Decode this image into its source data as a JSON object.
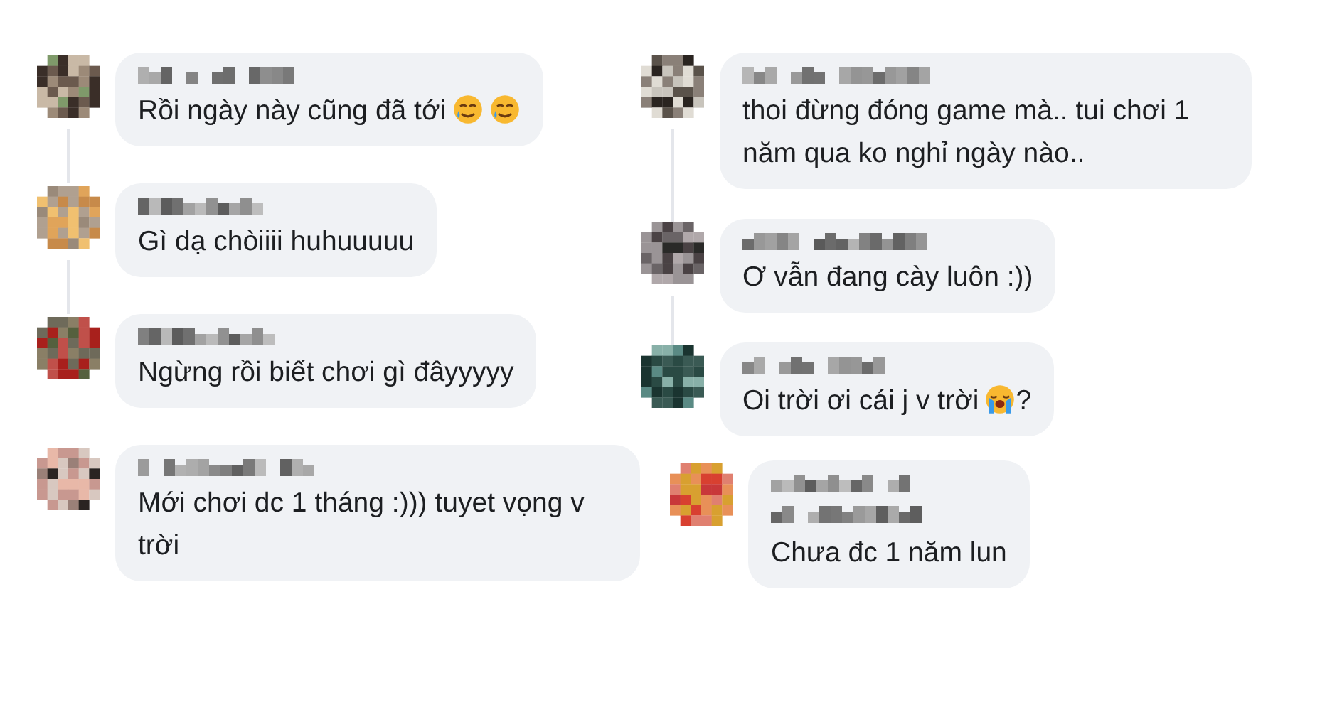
{
  "columns": [
    {
      "comments": [
        {
          "kind": "comment",
          "thread_line": true,
          "parts": [
            {
              "kind": "text",
              "text": "Rồi ngày này cũng đã tới"
            },
            {
              "kind": "smiling-tear"
            },
            {
              "kind": "smiling-tear"
            }
          ]
        },
        {
          "kind": "comment",
          "thread_line": true,
          "parts": [
            {
              "kind": "text",
              "text": "Gì dạ chòiiii huhuuuuu"
            }
          ]
        },
        {
          "kind": "comment",
          "thread_line": false,
          "parts": [
            {
              "kind": "text",
              "text": "Ngừng rồi biết chơi gì đâyyyyy"
            }
          ]
        },
        {
          "kind": "comment",
          "thread_line": false,
          "parts": [
            {
              "kind": "text",
              "text": "Mới chơi dc 1 tháng :))) tuyet vọng v trời"
            }
          ]
        }
      ]
    },
    {
      "comments": [
        {
          "kind": "comment",
          "thread_line": true,
          "parts": [
            {
              "kind": "text",
              "text": "thoi đừng đóng game mà.. tui chơi 1 năm qua ko nghỉ ngày nào.."
            }
          ]
        },
        {
          "kind": "comment",
          "thread_line": true,
          "parts": [
            {
              "kind": "text",
              "text": "Ơ vẫn đang cày luôn :))"
            }
          ]
        },
        {
          "kind": "comment",
          "thread_line": false,
          "parts": [
            {
              "kind": "text",
              "text": "Oi trời ơi cái j v trời"
            },
            {
              "kind": "crying"
            },
            {
              "kind": "text",
              "text": "?"
            }
          ]
        },
        {
          "kind": "reply",
          "thread_line": false,
          "parts": [
            {
              "kind": "text",
              "text": "Chưa đc 1 năm lun"
            }
          ]
        }
      ]
    }
  ]
}
